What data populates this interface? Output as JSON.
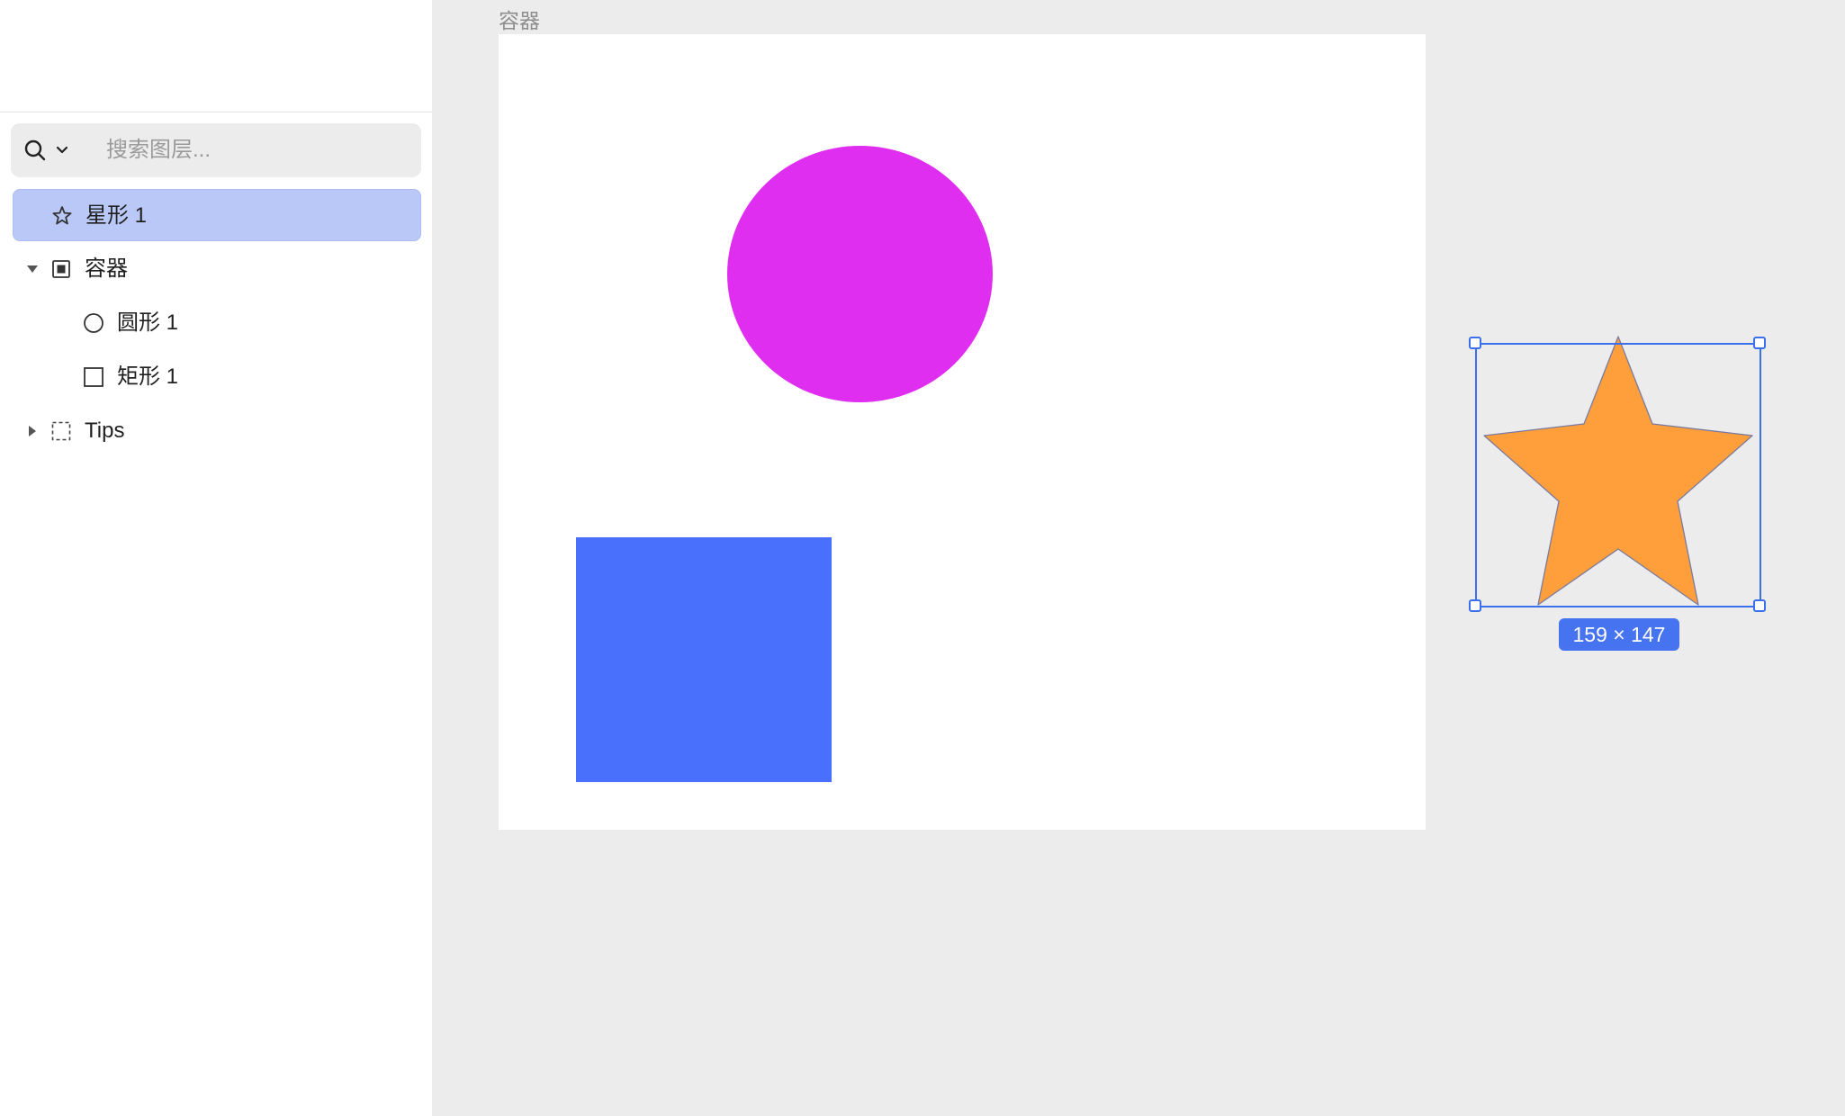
{
  "search": {
    "placeholder": "搜索图层..."
  },
  "layers": [
    {
      "name": "星形 1",
      "icon": "star-outline-icon",
      "selected": true
    },
    {
      "name": "容器",
      "icon": "frame-icon",
      "expanded": true
    },
    {
      "name": "圆形 1",
      "icon": "circle-outline-icon"
    },
    {
      "name": "矩形 1",
      "icon": "square-outline-icon"
    },
    {
      "name": "Tips",
      "icon": "dashed-group-icon",
      "expanded": false
    }
  ],
  "canvas": {
    "frame_label": "容器",
    "circle_color": "#e02ef0",
    "rect_color": "#4870fc",
    "star_color": "#ff9f3c",
    "selection_color": "#3c6fea",
    "size_badge": "159 × 147"
  }
}
